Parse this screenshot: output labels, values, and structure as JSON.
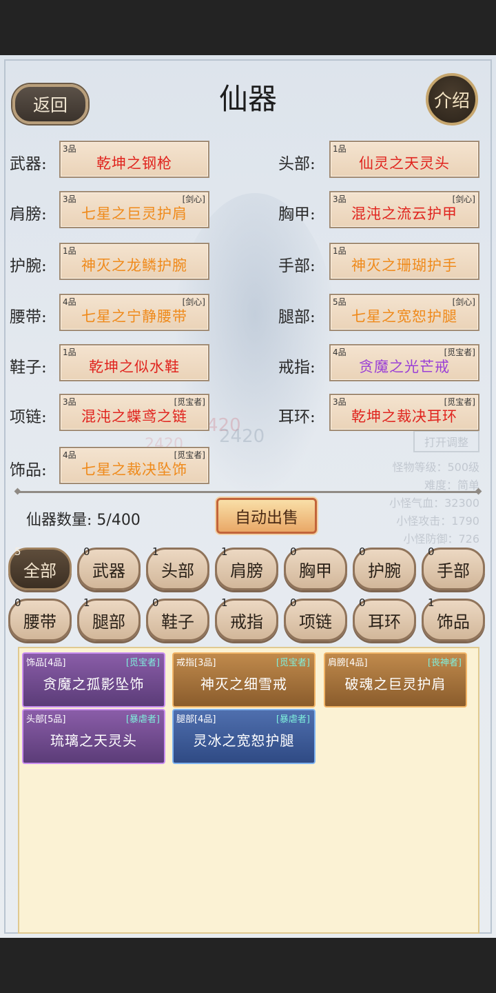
{
  "header": {
    "title": "仙器",
    "back_label": "返回",
    "intro_label": "介绍"
  },
  "equipped": [
    {
      "label": "武器:",
      "grade": "3品",
      "tag": "",
      "name": "乾坤之钢枪",
      "color": "#e0241e"
    },
    {
      "label": "头部:",
      "grade": "1品",
      "tag": "",
      "name": "仙灵之天灵头",
      "color": "#e0241e"
    },
    {
      "label": "肩膀:",
      "grade": "3品",
      "tag": "[剑心]",
      "name": "七星之巨灵护肩",
      "color": "#ef8a1b"
    },
    {
      "label": "胸甲:",
      "grade": "3品",
      "tag": "[剑心]",
      "name": "混沌之流云护甲",
      "color": "#e0241e"
    },
    {
      "label": "护腕:",
      "grade": "1品",
      "tag": "",
      "name": "神灭之龙鳞护腕",
      "color": "#ef8a1b"
    },
    {
      "label": "手部:",
      "grade": "1品",
      "tag": "",
      "name": "神灭之珊瑚护手",
      "color": "#ef8a1b"
    },
    {
      "label": "腰带:",
      "grade": "4品",
      "tag": "[剑心]",
      "name": "七星之宁静腰带",
      "color": "#ef8a1b"
    },
    {
      "label": "腿部:",
      "grade": "5品",
      "tag": "[剑心]",
      "name": "七星之宽恕护腿",
      "color": "#ef8a1b"
    },
    {
      "label": "鞋子:",
      "grade": "1品",
      "tag": "",
      "name": "乾坤之似水鞋",
      "color": "#e0241e"
    },
    {
      "label": "戒指:",
      "grade": "4品",
      "tag": "[觅宝者]",
      "name": "贪魔之光芒戒",
      "color": "#9a3fd6"
    },
    {
      "label": "项链:",
      "grade": "3品",
      "tag": "[觅宝者]",
      "name": "混沌之蝶鸢之链",
      "color": "#e0241e"
    },
    {
      "label": "耳环:",
      "grade": "3品",
      "tag": "[觅宝者]",
      "name": "乾坤之裁决耳环",
      "color": "#e0241e"
    },
    {
      "label": "饰品:",
      "grade": "4品",
      "tag": "[觅宝者]",
      "name": "七星之裁决坠饰",
      "color": "#ef8a1b"
    }
  ],
  "background_stats": {
    "open_adjust": "打开调整",
    "lines": [
      "怪物等级：500级",
      "难度：简单",
      "小怪气血：32300",
      "小怪攻击：1790",
      "小怪防御：726"
    ],
    "numbers": [
      "420",
      "2420",
      "2420"
    ]
  },
  "inventory": {
    "count_label": "仙器数量:",
    "count_value": "5/400",
    "auto_sell_label": "自动出售"
  },
  "filters": [
    {
      "label": "全部",
      "count": "5",
      "active": true
    },
    {
      "label": "武器",
      "count": "0"
    },
    {
      "label": "头部",
      "count": "1"
    },
    {
      "label": "肩膀",
      "count": "1"
    },
    {
      "label": "胸甲",
      "count": "0"
    },
    {
      "label": "护腕",
      "count": "0"
    },
    {
      "label": "手部",
      "count": "0"
    },
    {
      "label": "腰带",
      "count": "0"
    },
    {
      "label": "腿部",
      "count": "1"
    },
    {
      "label": "鞋子",
      "count": "0"
    },
    {
      "label": "戒指",
      "count": "1"
    },
    {
      "label": "项链",
      "count": "0"
    },
    {
      "label": "耳环",
      "count": "0"
    },
    {
      "label": "饰品",
      "count": "1"
    }
  ],
  "bag_items": [
    {
      "head": "饰品[4品]",
      "tag": "[觅宝者]",
      "name": "贪魔之孤影坠饰",
      "style": "purple"
    },
    {
      "head": "戒指[3品]",
      "tag": "[觅宝者]",
      "name": "神灭之细雪戒",
      "style": "orange"
    },
    {
      "head": "肩膀[4品]",
      "tag": "[丧神者]",
      "name": "破魂之巨灵护肩",
      "style": "orange"
    },
    {
      "head": "头部[5品]",
      "tag": "[暴虐者]",
      "name": "琉璃之天灵头",
      "style": "purple"
    },
    {
      "head": "腿部[4品]",
      "tag": "[暴虐者]",
      "name": "灵冰之宽恕护腿",
      "style": "blue"
    }
  ]
}
